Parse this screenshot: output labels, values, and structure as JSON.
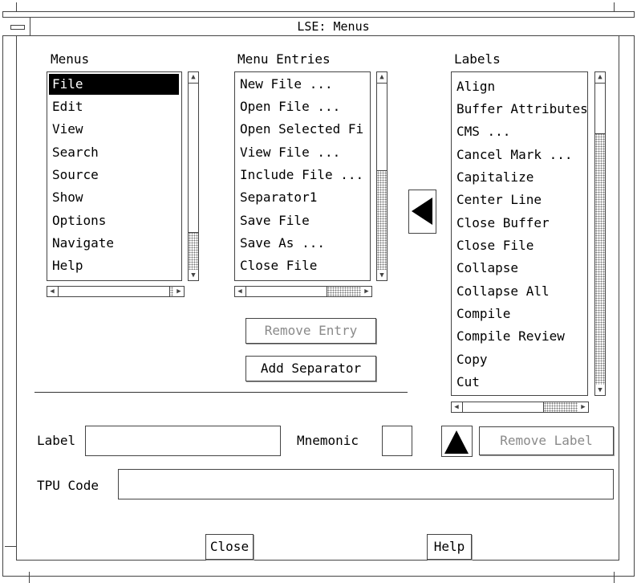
{
  "window": {
    "title": "LSE: Menus",
    "window_menu_icon": "window-menu-icon"
  },
  "menus": {
    "label": "Menus",
    "items": [
      "File",
      "Edit",
      "View",
      "Search",
      "Source",
      "Show",
      "Options",
      "Navigate",
      "Help"
    ],
    "selected": "File"
  },
  "menu_entries": {
    "label": "Menu Entries",
    "items": [
      "New File ...",
      "Open File ...",
      "Open Selected Fi",
      "View File ...",
      "Include File ...",
      "Separator1",
      "Save File",
      "Save As ...",
      "Close File"
    ]
  },
  "labels": {
    "label": "Labels",
    "items": [
      "Align",
      "Buffer Attributes",
      "CMS ...",
      "Cancel Mark ...",
      "Capitalize",
      "Center Line",
      "Close Buffer",
      "Close File",
      "Collapse",
      "Collapse All",
      "Compile",
      "Compile Review",
      "Copy",
      "Cut"
    ]
  },
  "buttons": {
    "remove_entry": "Remove Entry",
    "add_separator": "Add Separator",
    "remove_label": "Remove Label",
    "close": "Close",
    "help": "Help",
    "move_left_icon": "left-arrow-icon",
    "move_up_icon": "up-arrow-icon"
  },
  "fields": {
    "label_caption": "Label",
    "label_value": "",
    "mnemonic_caption": "Mnemonic",
    "mnemonic_value": "",
    "tpu_caption": "TPU Code",
    "tpu_value": ""
  },
  "colors": {
    "background": "#ffffff",
    "border": "#444444",
    "selection": "#000000",
    "disabled_text": "#8a8a8a"
  }
}
